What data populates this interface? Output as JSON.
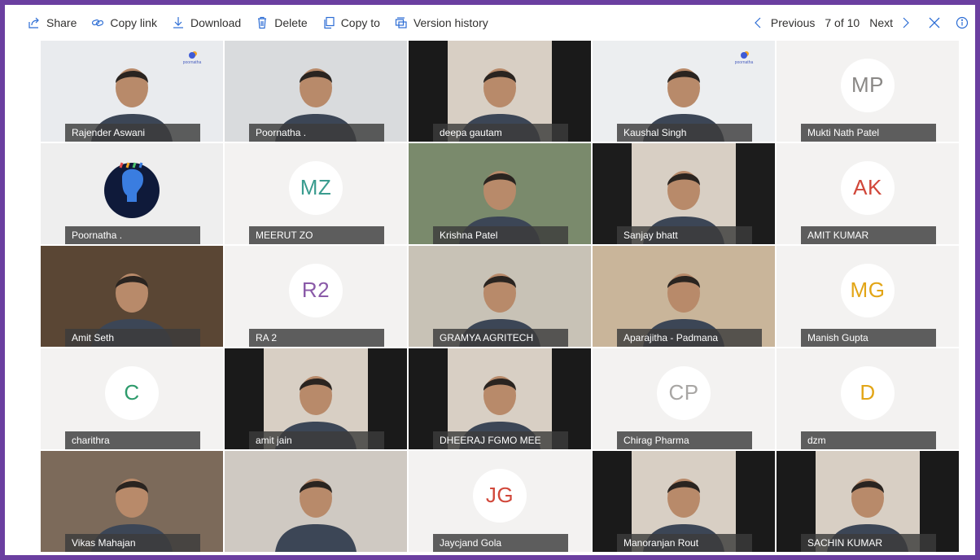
{
  "toolbar": {
    "share": "Share",
    "copy_link": "Copy link",
    "download": "Download",
    "delete": "Delete",
    "copy_to": "Copy to",
    "version_history": "Version history",
    "previous": "Previous",
    "counter": "7 of 10",
    "next": "Next"
  },
  "colors": {
    "frame": "#6b3fa0",
    "accent": "#2b6cd4"
  },
  "participants": [
    {
      "name": "Rajender Aswani",
      "type": "video",
      "bg": "#e9ebee"
    },
    {
      "name": "Poornatha .",
      "type": "video",
      "bg": "#d9dbdd"
    },
    {
      "name": "deepa gautam",
      "type": "video",
      "bg": "#1a1a1a"
    },
    {
      "name": "Kaushal Singh",
      "type": "video",
      "bg": "#eceef0"
    },
    {
      "name": "Mukti Nath Patel",
      "type": "avatar",
      "initials": "MP",
      "color": "#8a8886"
    },
    {
      "name": "Poornatha .",
      "type": "logo",
      "bg": "#eeeeee"
    },
    {
      "name": "MEERUT ZO",
      "type": "avatar",
      "initials": "MZ",
      "color": "#3a9c8f"
    },
    {
      "name": "Krishna Patel",
      "type": "video",
      "bg": "#7a8a6c"
    },
    {
      "name": "Sanjay bhatt",
      "type": "video",
      "bg": "#1c1c1c"
    },
    {
      "name": "AMIT KUMAR",
      "type": "avatar",
      "initials": "AK",
      "color": "#d1473a"
    },
    {
      "name": "Amit Seth",
      "type": "video",
      "bg": "#5a4634"
    },
    {
      "name": "RA 2",
      "type": "avatar",
      "initials": "R2",
      "color": "#8a5aa8"
    },
    {
      "name": "GRAMYA AGRITECH",
      "type": "video",
      "bg": "#c8c2b6"
    },
    {
      "name": "Aparajitha - Padmana",
      "type": "video",
      "bg": "#c9b59a"
    },
    {
      "name": "Manish Gupta",
      "type": "avatar",
      "initials": "MG",
      "color": "#e2a516"
    },
    {
      "name": "charithra",
      "type": "avatar",
      "initials": "C",
      "color": "#2e9b6c"
    },
    {
      "name": "amit jain",
      "type": "video",
      "bg": "#1a1a1a"
    },
    {
      "name": "DHEERAJ FGMO MEE",
      "type": "video",
      "bg": "#1a1a1a"
    },
    {
      "name": "Chirag Pharma",
      "type": "avatar",
      "initials": "CP",
      "color": "#a8a6a4"
    },
    {
      "name": "dzm",
      "type": "avatar",
      "initials": "D",
      "color": "#e2a516"
    },
    {
      "name": "Vikas Mahajan",
      "type": "video",
      "bg": "#7c6a5a"
    },
    {
      "name": "",
      "type": "video",
      "bg": "#cfc9c2"
    },
    {
      "name": "Jaycjand Gola",
      "type": "avatar",
      "initials": "JG",
      "color": "#d1473a"
    },
    {
      "name": "Manoranjan Rout",
      "type": "video",
      "bg": "#1a1a1a"
    },
    {
      "name": "SACHIN KUMAR",
      "type": "video",
      "bg": "#1a1a1a"
    }
  ],
  "logo_text": "poornatha"
}
